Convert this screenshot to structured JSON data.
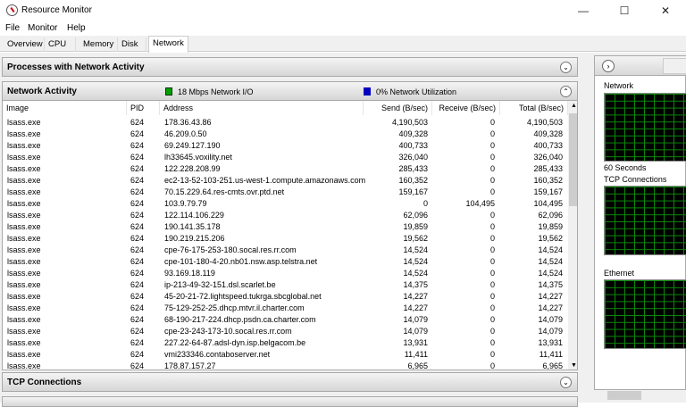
{
  "window": {
    "title": "Resource Monitor",
    "minimize": "—",
    "maximize": "☐",
    "close": "✕"
  },
  "menu": [
    "File",
    "Monitor",
    "Help"
  ],
  "tabs": [
    "Overview",
    "CPU",
    "Memory",
    "Disk",
    "Network"
  ],
  "sections": {
    "processes": "Processes with Network Activity",
    "activity": "Network Activity",
    "tcp": "TCP Connections"
  },
  "legend": {
    "io": "18 Mbps Network I/O",
    "util": "0% Network Utilization",
    "io_color": "#00a000",
    "util_color": "#0000c0"
  },
  "columns": [
    "Image",
    "PID",
    "Address",
    "Send (B/sec)",
    "Receive (B/sec)",
    "Total (B/sec)"
  ],
  "rows": [
    [
      "lsass.exe",
      "624",
      "178.36.43.86",
      "4,190,503",
      "0",
      "4,190,503"
    ],
    [
      "lsass.exe",
      "624",
      "46.209.0.50",
      "409,328",
      "0",
      "409,328"
    ],
    [
      "lsass.exe",
      "624",
      "69.249.127.190",
      "400,733",
      "0",
      "400,733"
    ],
    [
      "lsass.exe",
      "624",
      "lh33645.voxility.net",
      "326,040",
      "0",
      "326,040"
    ],
    [
      "lsass.exe",
      "624",
      "122.228.208.99",
      "285,433",
      "0",
      "285,433"
    ],
    [
      "lsass.exe",
      "624",
      "ec2-13-52-103-251.us-west-1.compute.amazonaws.com",
      "160,352",
      "0",
      "160,352"
    ],
    [
      "lsass.exe",
      "624",
      "70.15.229.64.res-cmts.ovr.ptd.net",
      "159,167",
      "0",
      "159,167"
    ],
    [
      "lsass.exe",
      "624",
      "103.9.79.79",
      "0",
      "104,495",
      "104,495"
    ],
    [
      "lsass.exe",
      "624",
      "122.114.106.229",
      "62,096",
      "0",
      "62,096"
    ],
    [
      "lsass.exe",
      "624",
      "190.141.35.178",
      "19,859",
      "0",
      "19,859"
    ],
    [
      "lsass.exe",
      "624",
      "190.219.215.206",
      "19,562",
      "0",
      "19,562"
    ],
    [
      "lsass.exe",
      "624",
      "cpe-76-175-253-180.socal.res.rr.com",
      "14,524",
      "0",
      "14,524"
    ],
    [
      "lsass.exe",
      "624",
      "cpe-101-180-4-20.nb01.nsw.asp.telstra.net",
      "14,524",
      "0",
      "14,524"
    ],
    [
      "lsass.exe",
      "624",
      "93.169.18.119",
      "14,524",
      "0",
      "14,524"
    ],
    [
      "lsass.exe",
      "624",
      "ip-213-49-32-151.dsl.scarlet.be",
      "14,375",
      "0",
      "14,375"
    ],
    [
      "lsass.exe",
      "624",
      "45-20-21-72.lightspeed.tukrga.sbcglobal.net",
      "14,227",
      "0",
      "14,227"
    ],
    [
      "lsass.exe",
      "624",
      "75-129-252-25.dhcp.mtvr.il.charter.com",
      "14,227",
      "0",
      "14,227"
    ],
    [
      "lsass.exe",
      "624",
      "68-190-217-224.dhcp.psdn.ca.charter.com",
      "14,079",
      "0",
      "14,079"
    ],
    [
      "lsass.exe",
      "624",
      "cpe-23-243-173-10.socal.res.rr.com",
      "14,079",
      "0",
      "14,079"
    ],
    [
      "lsass.exe",
      "624",
      "227.22-64-87.adsl-dyn.isp.belgacom.be",
      "13,931",
      "0",
      "13,931"
    ],
    [
      "lsass.exe",
      "624",
      "vmi233346.contaboserver.net",
      "11,411",
      "0",
      "11,411"
    ],
    [
      "lsass.exe",
      "624",
      "178.87.157.27",
      "6,965",
      "0",
      "6,965"
    ]
  ],
  "right": {
    "network": "Network",
    "seconds": "60 Seconds",
    "tcp": "TCP Connections",
    "ethernet": "Ethernet"
  }
}
